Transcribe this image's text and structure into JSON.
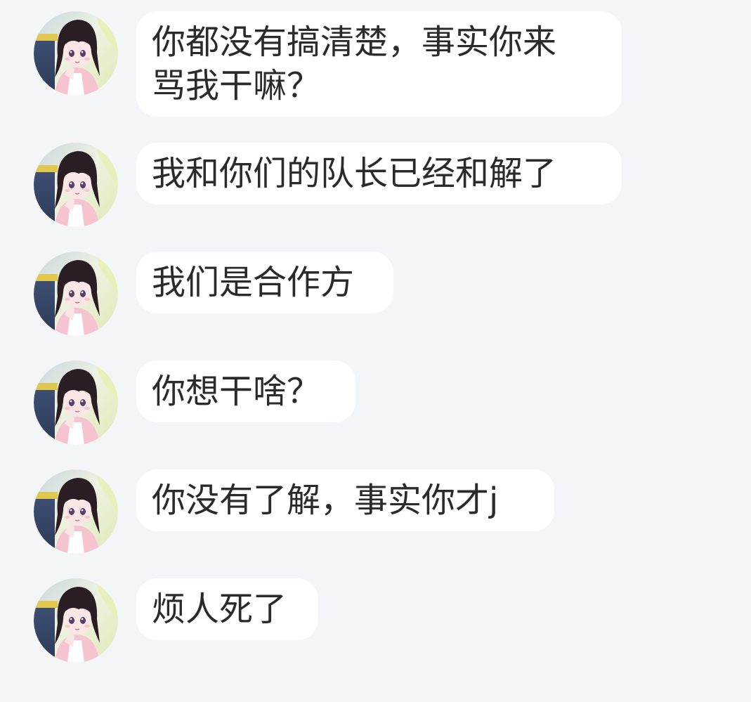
{
  "messages": [
    {
      "text": "你都没有搞清楚，事实你来\n骂我干嘛？",
      "avatar": "user-avatar-anime-girl"
    },
    {
      "text": "我和你们的队长已经和解了",
      "avatar": "user-avatar-anime-girl"
    },
    {
      "text": "我们是合作方",
      "avatar": "user-avatar-anime-girl"
    },
    {
      "text": "你想干啥？",
      "avatar": "user-avatar-anime-girl"
    },
    {
      "text": "你没有了解，事实你才j",
      "avatar": "user-avatar-anime-girl"
    },
    {
      "text": "烦人死了",
      "avatar": "user-avatar-anime-girl"
    }
  ],
  "colors": {
    "background": "#f4f5f7",
    "bubble": "#ffffff",
    "text": "#2a2a2a",
    "hair": "#2b1d24",
    "skin": "#fbe6e6",
    "clothing": "#f6c3d0"
  }
}
